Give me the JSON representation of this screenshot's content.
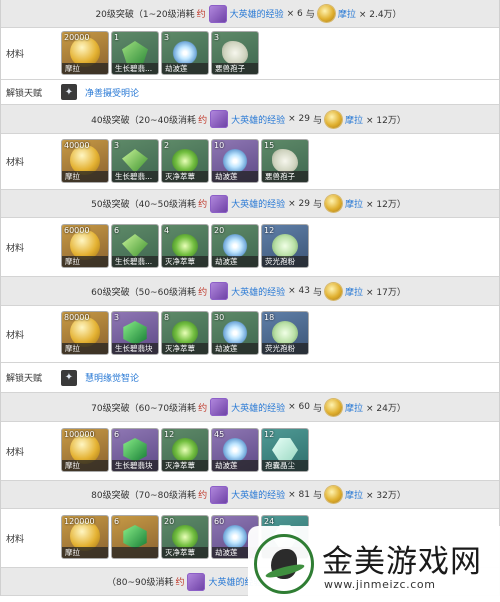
{
  "rows": {
    "r0": {
      "header_pre": "20级突破（1~20级消耗",
      "yue": "约",
      "xp_label": "大英雄的经验",
      "xp_qty": "× 6",
      "and": "与",
      "mora_label": "摩拉",
      "mora_qty": "× 2.4万）"
    },
    "r1": {
      "label": "材料",
      "items": [
        {
          "count": "20000",
          "name": "摩拉",
          "icon": "mora-icon"
        },
        {
          "count": "1",
          "name": "生长碧翡...",
          "icon": "green-gem-icon"
        },
        {
          "count": "3",
          "name": "劫波莲",
          "icon": "flower-icon"
        },
        {
          "count": "3",
          "name": "悪兽孢子",
          "icon": "spore-icon"
        }
      ]
    },
    "r2": {
      "label": "解锁天赋",
      "talent": "净善摄受明论",
      "icon": "talent-icon"
    },
    "r3": {
      "header_pre": "40级突破（20~40级消耗",
      "yue": "约",
      "xp_label": "大英雄的经验",
      "xp_qty": "× 29",
      "and": "与",
      "mora_label": "摩拉",
      "mora_qty": "× 12万）"
    },
    "r4": {
      "label": "材料",
      "items": [
        {
          "count": "40000",
          "name": "摩拉",
          "icon": "mora-icon"
        },
        {
          "count": "3",
          "name": "生长碧翡...",
          "icon": "green-gem-icon"
        },
        {
          "count": "2",
          "name": "灭净萃蕈",
          "icon": "orb-icon"
        },
        {
          "count": "10",
          "name": "劫波莲",
          "icon": "flower-icon"
        },
        {
          "count": "15",
          "name": "悪兽孢子",
          "icon": "spore-icon"
        }
      ]
    },
    "r5": {
      "header_pre": "50级突破（40~50级消耗",
      "yue": "约",
      "xp_label": "大英雄的经验",
      "xp_qty": "× 29",
      "and": "与",
      "mora_label": "摩拉",
      "mora_qty": "× 12万）"
    },
    "r6": {
      "label": "材料",
      "items": [
        {
          "count": "60000",
          "name": "摩拉",
          "icon": "mora-icon"
        },
        {
          "count": "6",
          "name": "生长碧翡...",
          "icon": "green-gem-icon"
        },
        {
          "count": "4",
          "name": "灭净萃蕈",
          "icon": "orb-icon"
        },
        {
          "count": "20",
          "name": "劫波莲",
          "icon": "flower-icon"
        },
        {
          "count": "12",
          "name": "荧光孢粉",
          "icon": "spore-icon"
        }
      ]
    },
    "r7": {
      "header_pre": "60级突破（50~60级消耗",
      "yue": "约",
      "xp_label": "大英雄的经验",
      "xp_qty": "× 43",
      "and": "与",
      "mora_label": "摩拉",
      "mora_qty": "× 17万）"
    },
    "r8": {
      "label": "材料",
      "items": [
        {
          "count": "80000",
          "name": "摩拉",
          "icon": "mora-icon"
        },
        {
          "count": "3",
          "name": "生长碧翡块",
          "icon": "green-gem-icon"
        },
        {
          "count": "8",
          "name": "灭净萃蕈",
          "icon": "orb-icon"
        },
        {
          "count": "30",
          "name": "劫波莲",
          "icon": "flower-icon"
        },
        {
          "count": "18",
          "name": "荧光孢粉",
          "icon": "spore-icon"
        }
      ]
    },
    "r9": {
      "label": "解锁天赋",
      "talent": "慧明缘觉智论",
      "icon": "talent-icon"
    },
    "r10": {
      "header_pre": "70级突破（60~70级消耗",
      "yue": "约",
      "xp_label": "大英雄的经验",
      "xp_qty": "× 60",
      "and": "与",
      "mora_label": "摩拉",
      "mora_qty": "× 24万）"
    },
    "r11": {
      "label": "材料",
      "items": [
        {
          "count": "100000",
          "name": "摩拉",
          "icon": "mora-icon"
        },
        {
          "count": "6",
          "name": "生长碧翡块",
          "icon": "green-gem-icon"
        },
        {
          "count": "12",
          "name": "灭净萃蕈",
          "icon": "orb-icon"
        },
        {
          "count": "45",
          "name": "劫波莲",
          "icon": "flower-icon"
        },
        {
          "count": "12",
          "name": "孢囊晶尘",
          "icon": "crystal-icon"
        }
      ]
    },
    "r12": {
      "header_pre": "80级突破（70~80级消耗",
      "yue": "约",
      "xp_label": "大英雄的经验",
      "xp_qty": "× 81",
      "and": "与",
      "mora_label": "摩拉",
      "mora_qty": "× 32万）"
    },
    "r13": {
      "label": "材料",
      "items": [
        {
          "count": "120000",
          "name": "摩拉",
          "icon": "mora-icon"
        },
        {
          "count": "6",
          "name": "",
          "icon": "green-gem-icon"
        },
        {
          "count": "20",
          "name": "灭净萃蕈",
          "icon": "orb-icon"
        },
        {
          "count": "60",
          "name": "劫波莲",
          "icon": "flower-icon"
        },
        {
          "count": "24",
          "name": "",
          "icon": "crystal-icon"
        }
      ]
    },
    "r14": {
      "header_pre": "（80~90级消耗",
      "yue": "约",
      "xp_label": "大英雄的经验",
      "xp_qty": "",
      "and": "",
      "mora_label": "",
      "mora_qty": ""
    }
  },
  "watermark": {
    "title": "金美游戏网",
    "url": "www.jinmeizc.com"
  }
}
